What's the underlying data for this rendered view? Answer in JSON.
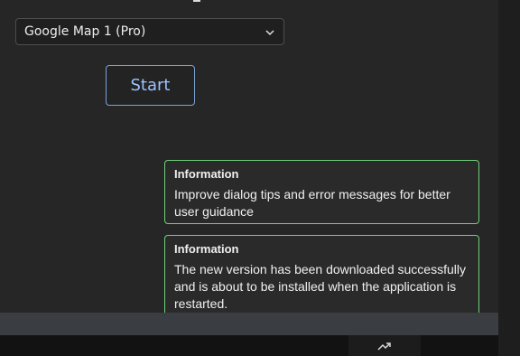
{
  "map_select": {
    "selected": "Google Map 1 (Pro)",
    "icon": "chevron-down-icon"
  },
  "start_button": {
    "label": "Start",
    "color": "#9cc2ff"
  },
  "notifications": [
    {
      "title": "Information",
      "message": "Improve dialog tips and error messages for better user guidance"
    },
    {
      "title": "Information",
      "message": "The new version has been downloaded successfully and is about to be installed when the application is restarted."
    }
  ],
  "taskbar": {
    "icon": "trending-up-icon"
  },
  "colors": {
    "toast_border": "#6fd07a",
    "accent": "#7aa2d6",
    "background": "#262626"
  }
}
